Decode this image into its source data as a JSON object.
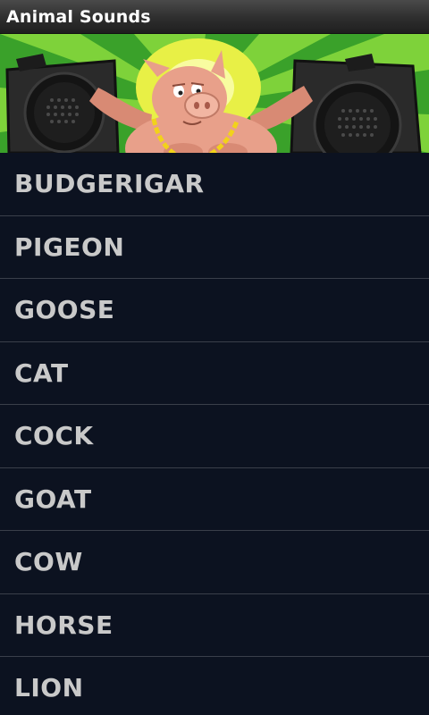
{
  "app": {
    "title": "Animal Sounds"
  },
  "banner": {
    "icon": "pig-dj-with-speakers-image",
    "colors": {
      "background_green": "#3aa12a",
      "burst_yellow": "#e8f046",
      "pig_pink": "#e8a08a",
      "chain_gold": "#f2d21a",
      "speaker_dark": "#2a2a2a"
    }
  },
  "animals": [
    {
      "label": "BUDGERIGAR"
    },
    {
      "label": "PIGEON"
    },
    {
      "label": "GOOSE"
    },
    {
      "label": "CAT"
    },
    {
      "label": "COCK"
    },
    {
      "label": "GOAT"
    },
    {
      "label": "COW"
    },
    {
      "label": "HORSE"
    },
    {
      "label": "LION"
    }
  ]
}
